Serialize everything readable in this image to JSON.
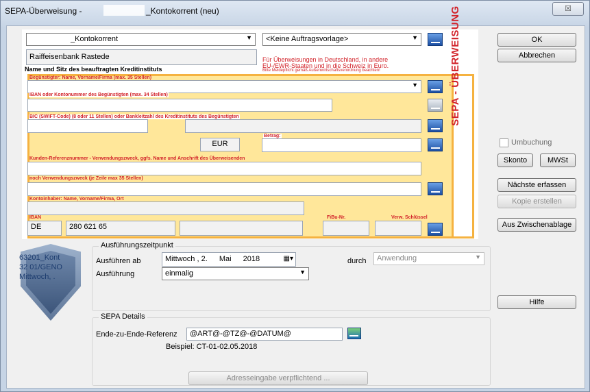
{
  "window": {
    "title_left": "SEPA-Überweisung -",
    "title_right": "_Kontokorrent (neu)",
    "close_glyph": "☒"
  },
  "form": {
    "account_combo": "_Kontokorrent",
    "template_combo": "<Keine Auftragsvorlage>",
    "bank_name": "Raiffeisenbank Rastede",
    "bank_caption": "Name und Sitz des beauftragten Kreditinstituts",
    "note_line1": "Für Überweisungen in Deutschland, in andere",
    "note_line2": "EU-/EWR-Staaten und in die Schweiz in Euro.",
    "note_line3": "Bitte Meldepflicht gemäß Außenwirtschaftsverordnung beachten!",
    "label_beneficiary": "Begünstigter: Name, Vorname/Firma (max. 35 Stellen)",
    "label_iban_beneficiary": "IBAN oder Kontonummer des Begünstigten (max. 34 Stellen)",
    "label_bic": "BIC (SWIFT-Code) (8 oder 11 Stellen) oder Bankleitzahl des Kreditinstituts des Begünstigten",
    "currency": "EUR",
    "label_amount": "Betrag:",
    "label_reference": "Kunden-Referenznummer - Verwendungszweck, ggfs. Name und Anschrift des Überweisenden",
    "label_purpose2": "noch Verwendungszweck (je Zeile max 35 Stellen)",
    "label_account_holder": "Kontoinhaber: Name, Vorname/Firma, Ort",
    "label_iban": "IBAN",
    "label_fibu": "FiBu-Nr.",
    "label_verw": "Verw. Schlüssel",
    "iban_country": "DE",
    "iban_part": "280 621 65",
    "sepa_vertical": "SEPA - ÜBERWEISUNG"
  },
  "buttons": {
    "ok": "OK",
    "cancel": "Abbrechen",
    "rebooking": "Umbuchung",
    "skonto": "Skonto",
    "mwst": "MWSt",
    "next": "Nächste erfassen",
    "copy": "Kopie erstellen",
    "clipboard": "Aus Zwischenablage",
    "help": "Hilfe"
  },
  "execution": {
    "group_title": "Ausführungszeitpunkt",
    "execute_from_label": "Ausführen ab",
    "date_weekday": "Mittwoch",
    "date_day": "2.",
    "date_month": "Mai",
    "date_year": "2018",
    "by_label": "durch",
    "by_value": "Anwendung",
    "execution_label": "Ausführung",
    "execution_value": "einmalig"
  },
  "sepa_details": {
    "group_title": "SEPA Details",
    "e2e_label": "Ende-zu-Ende-Referenz",
    "e2e_value": "@ART@-@TZ@-@DATUM@",
    "example": "Beispiel: CT-01-02.05.2018",
    "address_button": "Adresseingabe verpflichtend ..."
  },
  "shield": {
    "line1": "63201_Kont",
    "line2": "32 01/GENO",
    "line3": "Mittwoch, ."
  },
  "colors": {
    "accent_red": "#d2232a",
    "form_yellow": "#ffe79a",
    "form_border": "#f5b240",
    "icon_blue": "#1c4fa3"
  }
}
